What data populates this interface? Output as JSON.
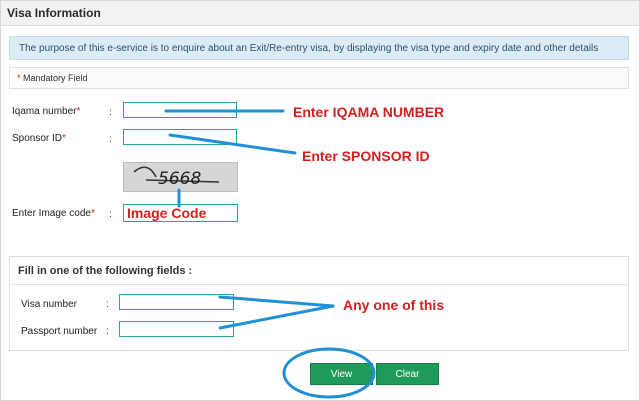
{
  "panel": {
    "title": "Visa Information"
  },
  "info": {
    "text": "The purpose of this e-service is to enquire about an Exit/Re-entry visa, by displaying the visa type and expiry date and other details"
  },
  "mandatory": {
    "asterisk": "*",
    "text": "Mandatory Field"
  },
  "form": {
    "iqama_label": "Iqama number",
    "sponsor_label": "Sponsor ID",
    "image_code_label": "Enter Image code",
    "required_mark": "*",
    "colon": ":",
    "captcha_text": "5668"
  },
  "optional": {
    "title": "Fill in one of the following fields :",
    "visa_label": "Visa number",
    "passport_label": "Passport number",
    "colon": ":"
  },
  "buttons": {
    "view": "View",
    "clear": "Clear"
  },
  "annotations": {
    "iqama": "Enter IQAMA NUMBER",
    "sponsor": "Enter SPONSOR ID",
    "image_code": "Image Code",
    "any_one": "Any one of this",
    "color": "#d21f1f",
    "arrow_color": "#1f8fd6"
  },
  "colors": {
    "button_green": "#1e9b5a",
    "field_border": "#2aa19a",
    "info_bg": "#dcecf7"
  }
}
